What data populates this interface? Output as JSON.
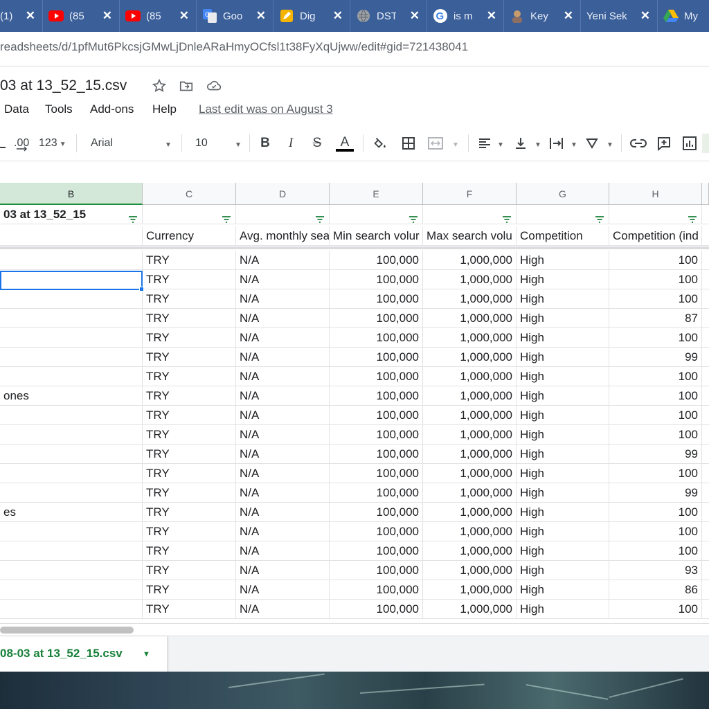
{
  "browser": {
    "tabs": [
      {
        "title": "(1)",
        "icon": "generic-icon"
      },
      {
        "title": "(85",
        "icon": "youtube-icon"
      },
      {
        "title": "(85",
        "icon": "youtube-icon"
      },
      {
        "title": "Goo",
        "icon": "google-translate-icon"
      },
      {
        "title": "Dig",
        "icon": "pen-icon"
      },
      {
        "title": "DST",
        "icon": "globe-icon"
      },
      {
        "title": "is m",
        "icon": "google-icon"
      },
      {
        "title": "Key",
        "icon": "avatar-icon"
      },
      {
        "title": "Yeni Sek",
        "icon": "none"
      },
      {
        "title": "My",
        "icon": "google-drive-icon"
      }
    ],
    "url": "readsheets/d/1pfMut6PkcsjGMwLjDnleARaHmyOCfsl1t38FyXqUjww/edit#gid=721438041"
  },
  "doc": {
    "title": "03 at 13_52_15.csv",
    "last_edit": "Last edit was on August 3"
  },
  "menu": {
    "data": "Data",
    "tools": "Tools",
    "addons": "Add-ons",
    "help": "Help"
  },
  "toolbar": {
    "decimal": ".00",
    "format_more": "123",
    "font": "Arial",
    "font_size": "10"
  },
  "grid": {
    "columns": [
      "B",
      "C",
      "D",
      "E",
      "F",
      "G",
      "H"
    ],
    "filter_row": [
      "03 at 13_52_15",
      "",
      "",
      "",
      "",
      "",
      ""
    ],
    "header_row": [
      "",
      "Currency",
      "Avg. monthly sea",
      "Min search volur",
      "Max search volu",
      "Competition",
      "Competition (ind"
    ],
    "rows": [
      [
        "",
        "TRY",
        "N/A",
        "100,000",
        "1,000,000",
        "High",
        "100"
      ],
      [
        "",
        "TRY",
        "N/A",
        "100,000",
        "1,000,000",
        "High",
        "100"
      ],
      [
        "",
        "TRY",
        "N/A",
        "100,000",
        "1,000,000",
        "High",
        "100"
      ],
      [
        "",
        "TRY",
        "N/A",
        "100,000",
        "1,000,000",
        "High",
        "87"
      ],
      [
        "",
        "TRY",
        "N/A",
        "100,000",
        "1,000,000",
        "High",
        "100"
      ],
      [
        "",
        "TRY",
        "N/A",
        "100,000",
        "1,000,000",
        "High",
        "99"
      ],
      [
        "",
        "TRY",
        "N/A",
        "100,000",
        "1,000,000",
        "High",
        "100"
      ],
      [
        "ones",
        "TRY",
        "N/A",
        "100,000",
        "1,000,000",
        "High",
        "100"
      ],
      [
        "",
        "TRY",
        "N/A",
        "100,000",
        "1,000,000",
        "High",
        "100"
      ],
      [
        "",
        "TRY",
        "N/A",
        "100,000",
        "1,000,000",
        "High",
        "100"
      ],
      [
        "",
        "TRY",
        "N/A",
        "100,000",
        "1,000,000",
        "High",
        "99"
      ],
      [
        "",
        "TRY",
        "N/A",
        "100,000",
        "1,000,000",
        "High",
        "100"
      ],
      [
        "",
        "TRY",
        "N/A",
        "100,000",
        "1,000,000",
        "High",
        "99"
      ],
      [
        "es",
        "TRY",
        "N/A",
        "100,000",
        "1,000,000",
        "High",
        "100"
      ],
      [
        "",
        "TRY",
        "N/A",
        "100,000",
        "1,000,000",
        "High",
        "100"
      ],
      [
        "",
        "TRY",
        "N/A",
        "100,000",
        "1,000,000",
        "High",
        "100"
      ],
      [
        "",
        "TRY",
        "N/A",
        "100,000",
        "1,000,000",
        "High",
        "93"
      ],
      [
        "",
        "TRY",
        "N/A",
        "100,000",
        "1,000,000",
        "High",
        "86"
      ],
      [
        "",
        "TRY",
        "N/A",
        "100,000",
        "1,000,000",
        "High",
        "100"
      ]
    ]
  },
  "sheet_tab": {
    "label": "08-03 at 13_52_15.csv"
  },
  "colors": {
    "tabbar": "#3a5f99",
    "selected_column_header": "#d3e8d8",
    "selection_border": "#1a73e8",
    "sheet_tab_text": "#188038"
  }
}
